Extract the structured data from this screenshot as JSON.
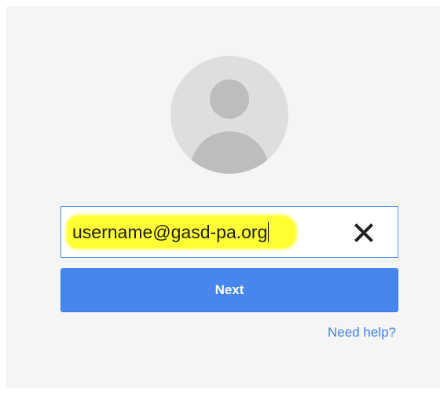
{
  "login": {
    "email_value": "username@gasd-pa.org",
    "next_label": "Next",
    "help_label": "Need help?"
  },
  "icons": {
    "avatar": "default-user-avatar-icon",
    "clear": "close-x-icon"
  },
  "colors": {
    "accent": "#4787ed",
    "highlight": "#ffff33",
    "link": "#427fed",
    "card_bg": "#f5f5f5"
  }
}
